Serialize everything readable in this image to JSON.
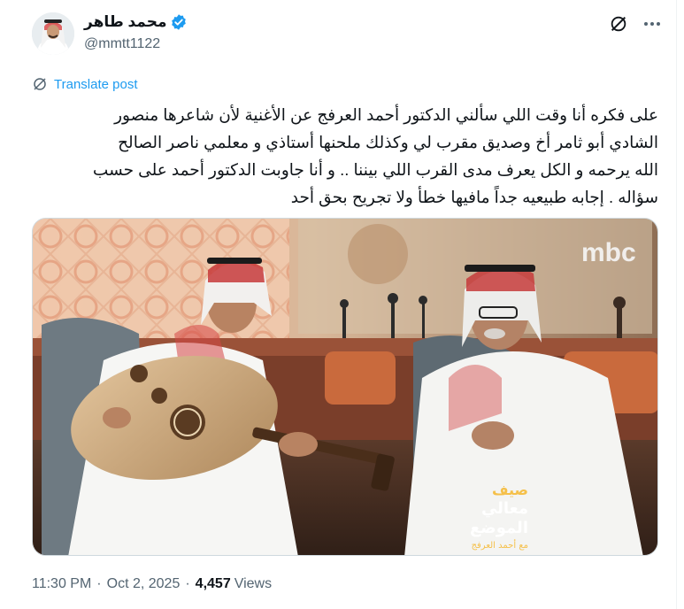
{
  "author": {
    "display_name": "محمد طاهر",
    "handle": "@mmtt1122",
    "verified": true
  },
  "actions": {
    "grok_icon": "grok-icon",
    "more_icon": "more-icon"
  },
  "translate": {
    "label": "Translate post"
  },
  "post": {
    "lines": [
      "على فكره أنا وقت اللي سألني  الدكتور أحمد العرفج عن الأغنية لأن شاعرها منصور",
      "الشادي أبو ثامر أخ وصديق مقرب لي وكذلك ملحنها أستاذي و معلمي ناصر الصالح",
      "الله يرحمه و الكل يعرف مدى القرب اللي بيننا .. و أنا جاوبت الدكتور أحمد على حسب",
      "سؤاله .  إجابه طبيعيه جداً مافيها خطأ ولا تجريح بحق أحد"
    ]
  },
  "media": {
    "channel_logo": "mbc",
    "show_logo_lines": [
      "صيف",
      "معالي",
      "الموضع",
      "مع أحمد العرفج"
    ]
  },
  "footer": {
    "time": "11:30 PM",
    "date": "Oct 2, 2025",
    "views_count": "4,457",
    "views_label": "Views"
  },
  "colors": {
    "accent": "#1d9bf0",
    "text": "#0f1419",
    "secondary": "#536471"
  }
}
